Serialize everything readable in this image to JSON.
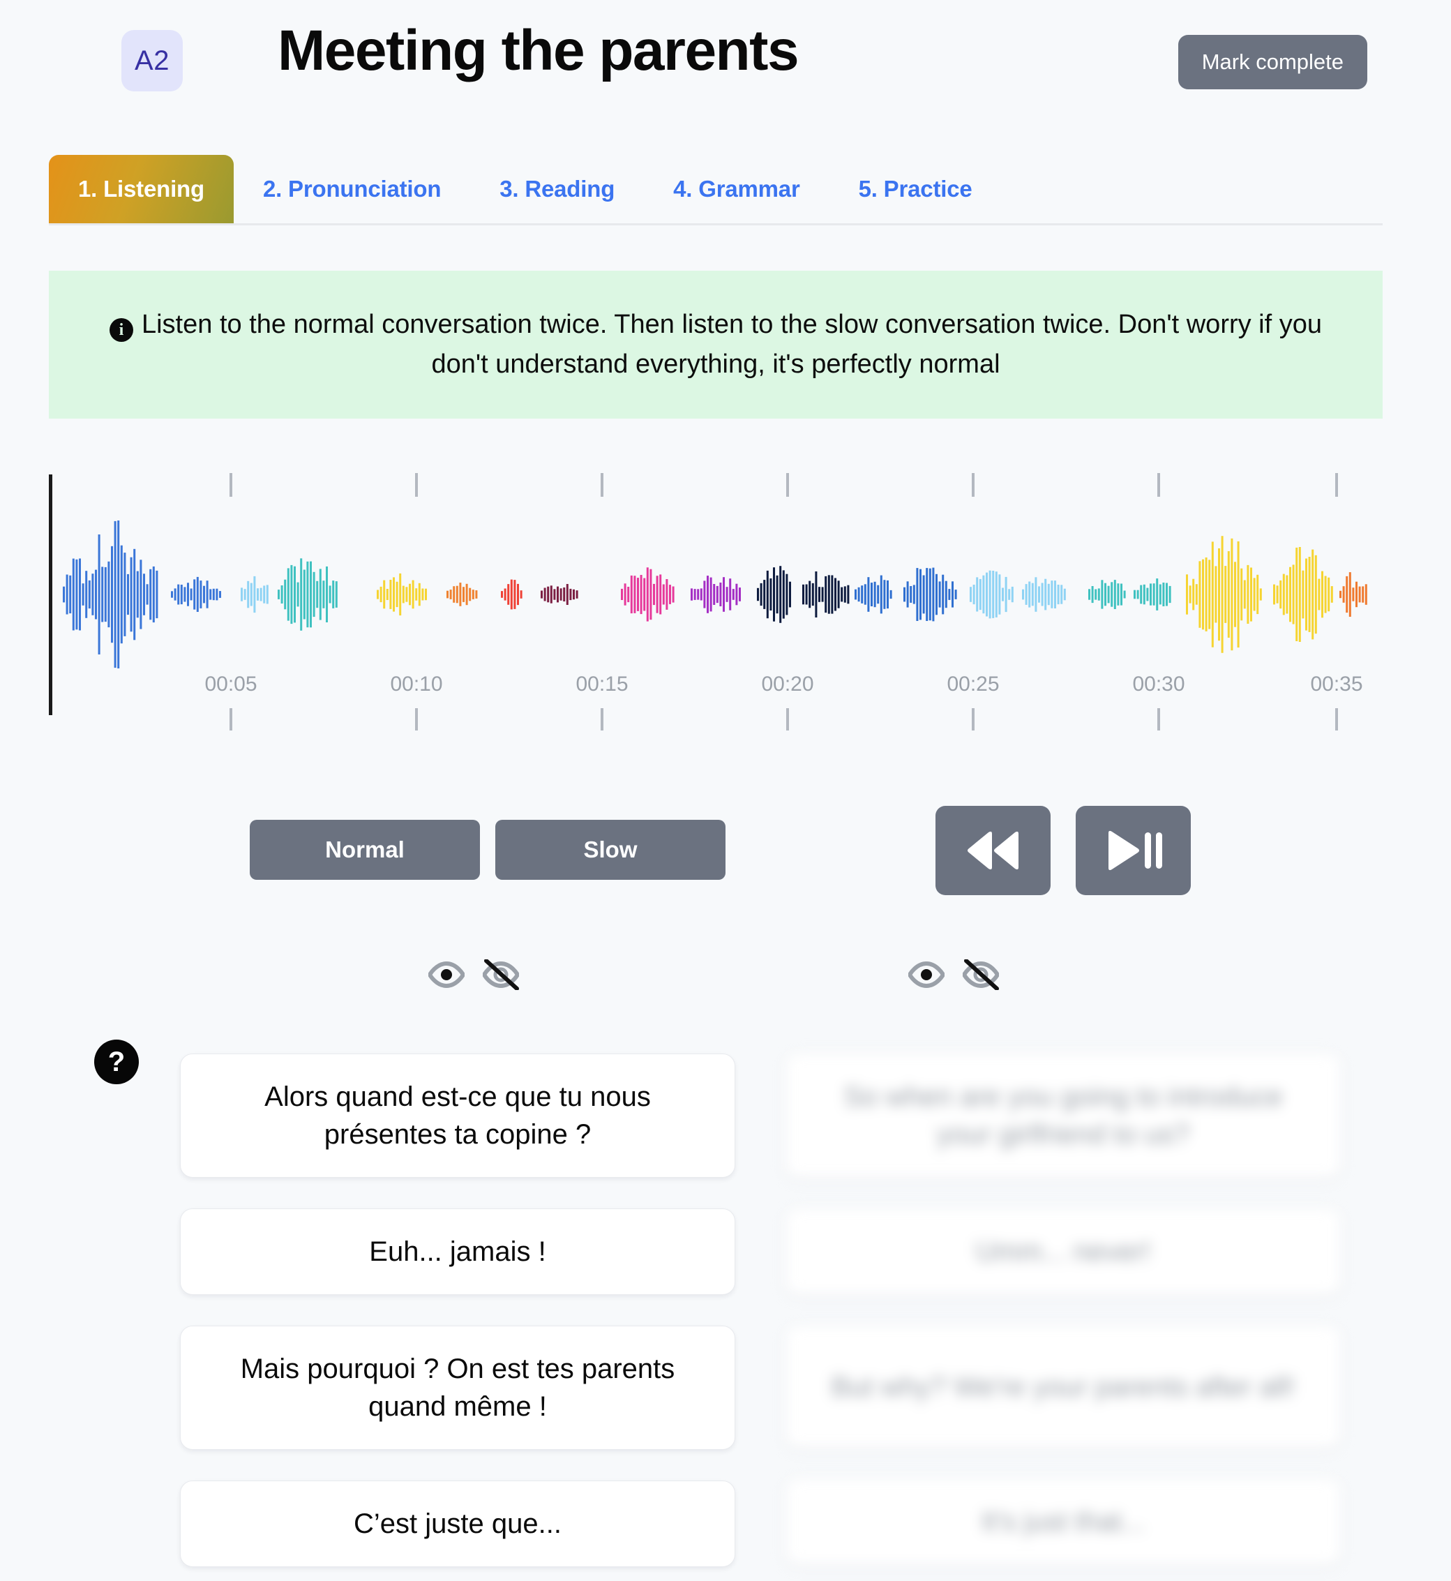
{
  "header": {
    "level_badge": "A2",
    "title": "Meeting the parents",
    "mark_complete_label": "Mark complete"
  },
  "tabs": [
    {
      "label": "1. Listening",
      "active": true
    },
    {
      "label": "2. Pronunciation",
      "active": false
    },
    {
      "label": "3. Reading",
      "active": false
    },
    {
      "label": "4. Grammar",
      "active": false
    },
    {
      "label": "5. Practice",
      "active": false
    }
  ],
  "info_banner": {
    "icon": "info-icon",
    "text": "Listen to the normal conversation twice. Then listen to the slow conversation twice. Don't worry if you don't understand everything, it's perfectly normal",
    "background_color": "#dcf7e3"
  },
  "waveform": {
    "time_labels": [
      "00:05",
      "00:10",
      "00:15",
      "00:20",
      "00:25",
      "00:30",
      "00:35"
    ],
    "segment_colors": [
      "#3a76d8",
      "#8fd3f4",
      "#3fc1c0",
      "#f6d431",
      "#ef8230",
      "#ef4136",
      "#7b1f42",
      "#e6399b",
      "#a42ec4",
      "#0d1b3e",
      "#2f6fd0",
      "#8fd3f4",
      "#3fc1c0",
      "#f6d431",
      "#ef7a2f"
    ],
    "axis_color": "#1a1a1a",
    "tick_color": "#9aa0a8"
  },
  "controls": {
    "speed_buttons": [
      {
        "label": "Normal"
      },
      {
        "label": "Slow"
      }
    ],
    "transport_buttons": [
      {
        "name": "rewind-button"
      },
      {
        "name": "play-pause-button"
      }
    ],
    "button_color": "#6b7280"
  },
  "visibility_toggles": {
    "left": [
      {
        "icon": "eye-icon",
        "state": "visible"
      },
      {
        "icon": "eye-off-icon",
        "state": "hidden"
      }
    ],
    "right": [
      {
        "icon": "eye-icon",
        "state": "visible"
      },
      {
        "icon": "eye-off-icon",
        "state": "hidden"
      }
    ]
  },
  "help_badge": "?",
  "dialogue": {
    "source_lines": [
      "Alors quand est-ce que tu nous présentes ta copine ?",
      "Euh... jamais !",
      "Mais pourquoi ? On est tes parents quand même !",
      "C’est juste que..."
    ],
    "translation_lines": [
      "So when are you going to introduce your girlfriend to us?",
      "Umm... never!",
      "But why? We're your parents after all!",
      "It's just that..."
    ]
  }
}
